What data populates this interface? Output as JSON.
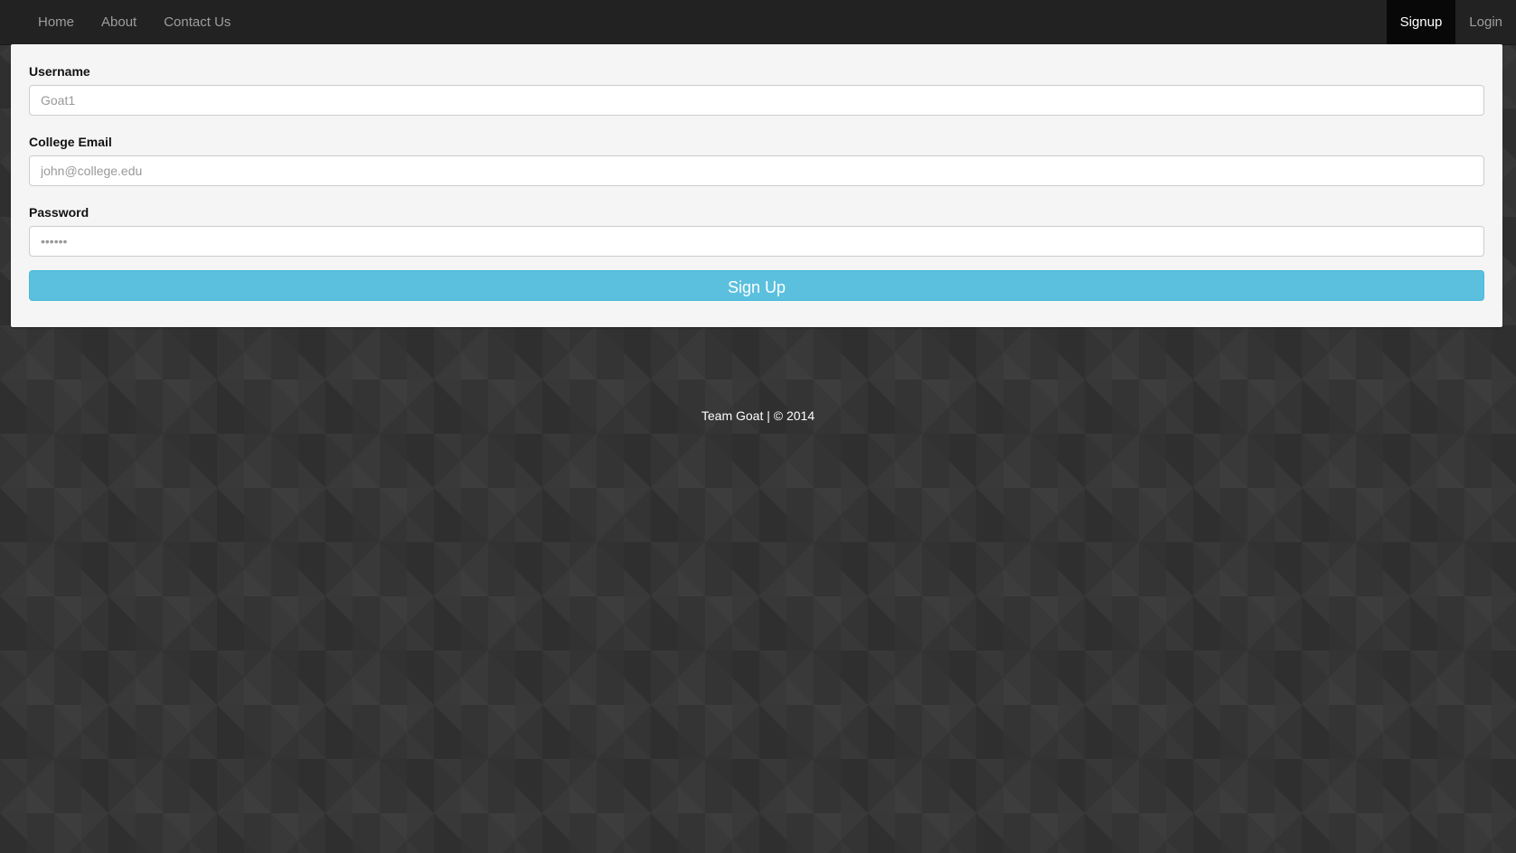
{
  "nav": {
    "left": [
      {
        "label": "Home"
      },
      {
        "label": "About"
      },
      {
        "label": "Contact Us"
      }
    ],
    "signup_label": "Signup",
    "login_label": "Login"
  },
  "form": {
    "username": {
      "label": "Username",
      "placeholder": "Goat1"
    },
    "email": {
      "label": "College Email",
      "placeholder": "john@college.edu"
    },
    "password": {
      "label": "Password",
      "placeholder": "••••••"
    },
    "submit_label": "Sign Up"
  },
  "footer": {
    "text": "Team Goat | © 2014"
  },
  "colors": {
    "navbar": "#222222",
    "active_nav": "#080808",
    "panel": "#f5f5f5",
    "button": "#5bc0de",
    "background": "#343434"
  }
}
